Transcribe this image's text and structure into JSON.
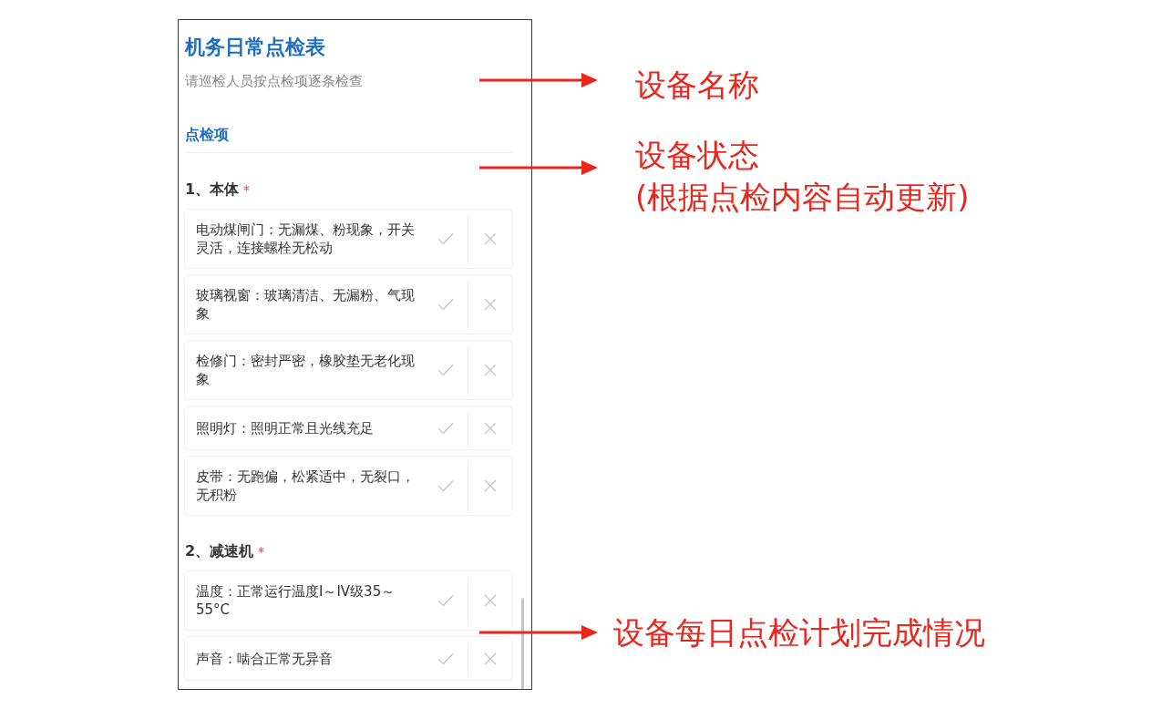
{
  "form": {
    "title": "机务日常点检表",
    "subtitle": "请巡检人员按点检项逐条检查",
    "section_title": "点检项",
    "groups": [
      {
        "title": "1、本体",
        "required": true,
        "items": [
          {
            "text": "电动煤闸门：无漏煤、粉现象，开关灵活，连接螺栓无松动",
            "options": [
              {
                "kind": "pass",
                "selected": false
              },
              {
                "kind": "fail",
                "selected": false
              }
            ]
          },
          {
            "text": "玻璃视窗：玻璃清洁、无漏粉、气现象",
            "options": [
              {
                "kind": "pass",
                "selected": false
              },
              {
                "kind": "fail",
                "selected": false
              }
            ]
          },
          {
            "text": "检修门：密封严密，橡胶垫无老化现象",
            "options": [
              {
                "kind": "pass",
                "selected": false
              },
              {
                "kind": "fail",
                "selected": false
              }
            ]
          },
          {
            "text": "照明灯：照明正常且光线充足",
            "options": [
              {
                "kind": "pass",
                "selected": false
              },
              {
                "kind": "fail",
                "selected": false
              }
            ]
          },
          {
            "text": "皮带：无跑偏，松紧适中，无裂口，无积粉",
            "options": [
              {
                "kind": "pass",
                "selected": false
              },
              {
                "kind": "fail",
                "selected": false
              }
            ]
          }
        ]
      },
      {
        "title": "2、减速机",
        "required": true,
        "items": [
          {
            "text": "温度：正常运行温度I～IV级35～55°C",
            "options": [
              {
                "kind": "pass",
                "selected": false
              },
              {
                "kind": "fail",
                "selected": false
              }
            ]
          },
          {
            "text": "声音：啮合正常无异音",
            "options": [
              {
                "kind": "pass",
                "selected": false
              },
              {
                "kind": "fail",
                "selected": false
              }
            ]
          }
        ]
      }
    ]
  },
  "annotations": [
    {
      "lines": [
        "设备名称"
      ]
    },
    {
      "lines": [
        "设备状态",
        "(根据点检内容自动更新)"
      ]
    },
    {
      "lines": [
        "设备每日点检计划完成情况"
      ]
    }
  ]
}
